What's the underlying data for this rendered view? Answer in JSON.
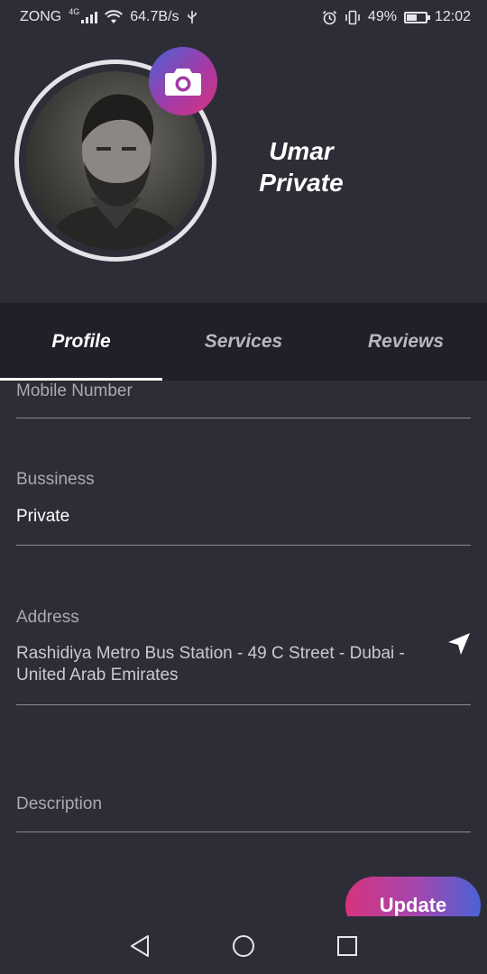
{
  "status_bar": {
    "carrier": "ZONG",
    "network_type": "4G",
    "data_speed": "64.7B/s",
    "battery_percent": "49%",
    "time": "12:02",
    "icons": [
      "signal-icon",
      "wifi-icon",
      "usb-icon",
      "alarm-icon",
      "vibrate-icon",
      "battery-icon"
    ]
  },
  "profile": {
    "first_name": "Umar",
    "last_name": "Private",
    "avatar_icon": "profile-photo",
    "camera_icon": "camera-icon"
  },
  "tabs": [
    {
      "label": "Profile",
      "active": true
    },
    {
      "label": "Services",
      "active": false
    },
    {
      "label": "Reviews",
      "active": false
    }
  ],
  "form": {
    "mobile": {
      "label": "Mobile Number",
      "value": ""
    },
    "business": {
      "label": "Bussiness",
      "value": "Private"
    },
    "address": {
      "label": "Address",
      "value": "Rashidiya Metro Bus Station - 49 C Street - Dubai - United Arab Emirates"
    },
    "description": {
      "label": "Description",
      "value": ""
    }
  },
  "update_button": {
    "label": "Update"
  },
  "colors": {
    "background": "#2d2d37",
    "tab_bar": "#1f2028",
    "accent_pink": "#d8337e",
    "accent_blue": "#4a63d6"
  }
}
